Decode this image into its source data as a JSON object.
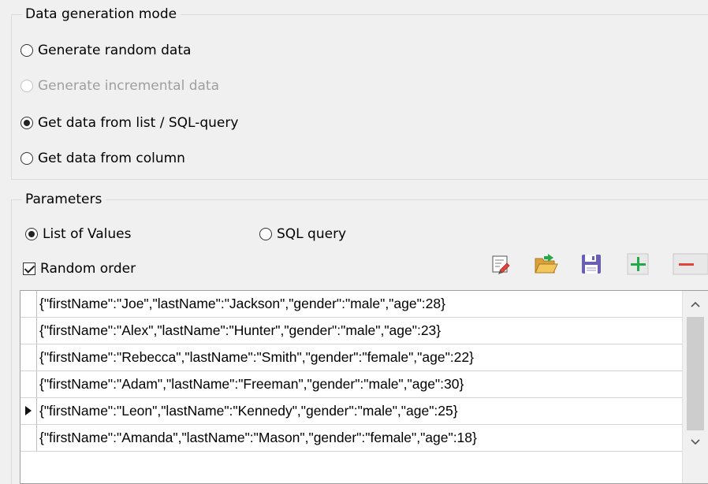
{
  "mode_group": {
    "title": "Data generation mode",
    "options": [
      {
        "label": "Generate random data",
        "checked": false,
        "disabled": false
      },
      {
        "label": "Generate incremental data",
        "checked": false,
        "disabled": true
      },
      {
        "label": "Get data from list / SQL-query",
        "checked": true,
        "disabled": false
      },
      {
        "label": "Get data from column",
        "checked": false,
        "disabled": false
      }
    ]
  },
  "params_group": {
    "title": "Parameters",
    "source_options": [
      {
        "label": "List of Values",
        "checked": true
      },
      {
        "label": "SQL query",
        "checked": false
      }
    ],
    "random_order": {
      "label": "Random order",
      "checked": true
    }
  },
  "toolbar": {
    "buttons": [
      {
        "name": "edit-list-button",
        "icon": "edit-list-icon"
      },
      {
        "name": "open-file-button",
        "icon": "folder-open-icon"
      },
      {
        "name": "save-button",
        "icon": "floppy-disk-icon"
      },
      {
        "name": "add-button",
        "icon": "plus-icon"
      },
      {
        "name": "remove-button",
        "icon": "minus-icon"
      }
    ]
  },
  "values_list": {
    "active_row": 4,
    "rows": [
      "{\"firstName\":\"Joe\",\"lastName\":\"Jackson\",\"gender\":\"male\",\"age\":28}",
      "{\"firstName\":\"Alex\",\"lastName\":\"Hunter\",\"gender\":\"male\",\"age\":23}",
      "{\"firstName\":\"Rebecca\",\"lastName\":\"Smith\",\"gender\":\"female\",\"age\":22}",
      "{\"firstName\":\"Adam\",\"lastName\":\"Freeman\",\"gender\":\"male\",\"age\":30}",
      "{\"firstName\":\"Leon\",\"lastName\":\"Kennedy\",\"gender\":\"male\",\"age\":25}",
      "{\"firstName\":\"Amanda\",\"lastName\":\"Mason\",\"gender\":\"female\",\"age\":18}"
    ]
  },
  "colors": {
    "plus": "#22a94a",
    "minus": "#e0443a",
    "folder": "#e6b34a",
    "floppy": "#6a5fb5"
  }
}
